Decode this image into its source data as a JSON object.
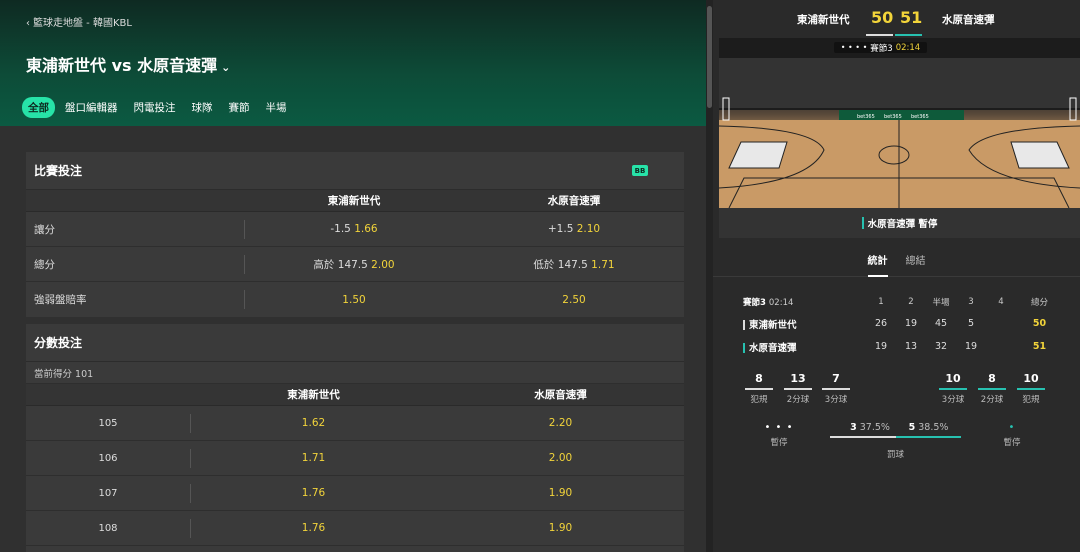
{
  "breadcrumb": "籃球走地盤 - 韓國KBL",
  "match_title": "東浦新世代 vs 水原音速彈",
  "tabs": [
    "全部",
    "盤口編輯器",
    "閃電投注",
    "球隊",
    "賽節",
    "半場"
  ],
  "match_bets": {
    "title": "比賽投注",
    "badge": "BB",
    "home": "東浦新世代",
    "away": "水原音速彈",
    "rows": [
      {
        "label": "讓分",
        "home_line": "-1.5",
        "home_odds": "1.66",
        "away_line": "+1.5",
        "away_odds": "2.10"
      },
      {
        "label": "總分",
        "home_line": "高於 147.5",
        "home_odds": "2.00",
        "away_line": "低於 147.5",
        "away_odds": "1.71"
      },
      {
        "label": "強弱盤賠率",
        "home_line": "",
        "home_odds": "1.50",
        "away_line": "",
        "away_odds": "2.50"
      }
    ]
  },
  "points_bets": {
    "title": "分數投注",
    "current": "當前得分 101",
    "home": "東浦新世代",
    "away": "水原音速彈",
    "rows": [
      {
        "points": "105",
        "home": "1.62",
        "away": "2.20"
      },
      {
        "points": "106",
        "home": "1.71",
        "away": "2.00"
      },
      {
        "points": "107",
        "home": "1.76",
        "away": "1.90"
      },
      {
        "points": "108",
        "home": "1.76",
        "away": "1.90"
      }
    ]
  },
  "scoreboard": {
    "home": "東浦新世代",
    "away": "水原音速彈",
    "home_score": "50",
    "away_score": "51",
    "period_clock": "賽節3",
    "clock": "02:14",
    "status": "水原音速彈 暫停",
    "tabs": [
      "統計",
      "總結"
    ]
  },
  "quarters": {
    "period_label": "賽節3",
    "clock": "02:14",
    "headers": [
      "1",
      "2",
      "半場",
      "3",
      "4",
      "總分"
    ],
    "home": {
      "name": "東浦新世代",
      "q": [
        "26",
        "19",
        "45",
        "5",
        ""
      ],
      "total": "50"
    },
    "away": {
      "name": "水原音速彈",
      "q": [
        "19",
        "13",
        "32",
        "19",
        ""
      ],
      "total": "51"
    }
  },
  "stats": {
    "home": [
      {
        "v": "8",
        "l": "犯規"
      },
      {
        "v": "13",
        "l": "2分球"
      },
      {
        "v": "7",
        "l": "3分球"
      }
    ],
    "away": [
      {
        "v": "10",
        "l": "3分球"
      },
      {
        "v": "8",
        "l": "2分球"
      },
      {
        "v": "10",
        "l": "犯規"
      }
    ],
    "home_timeout_label": "暫停",
    "away_timeout_label": "暫停",
    "home_timeouts_dots": "• • •",
    "away_timeouts_dots": "•",
    "free_throws": {
      "label": "罰球",
      "home_made": "3",
      "home_pct": "37.5%",
      "away_made": "5",
      "away_pct": "38.5%"
    }
  },
  "colors": {
    "accent": "#27e3a8",
    "odds": "#f2d43a",
    "away_team": "#27c1b0"
  }
}
